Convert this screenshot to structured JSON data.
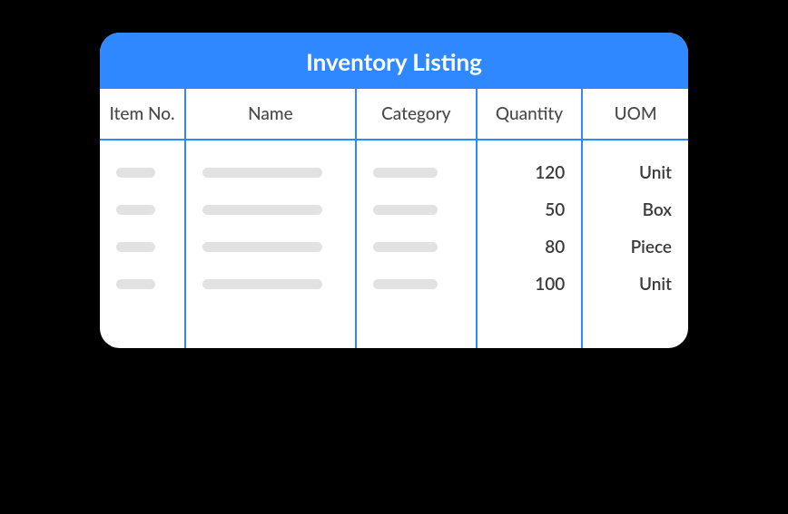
{
  "header": {
    "title": "Inventory Listing"
  },
  "columns": {
    "item_no": "Item No.",
    "name": "Name",
    "category": "Category",
    "quantity": "Quantity",
    "uom": "UOM"
  },
  "rows": [
    {
      "quantity": "120",
      "uom": "Unit"
    },
    {
      "quantity": "50",
      "uom": "Box"
    },
    {
      "quantity": "80",
      "uom": "Piece"
    },
    {
      "quantity": "100",
      "uom": "Unit"
    }
  ]
}
